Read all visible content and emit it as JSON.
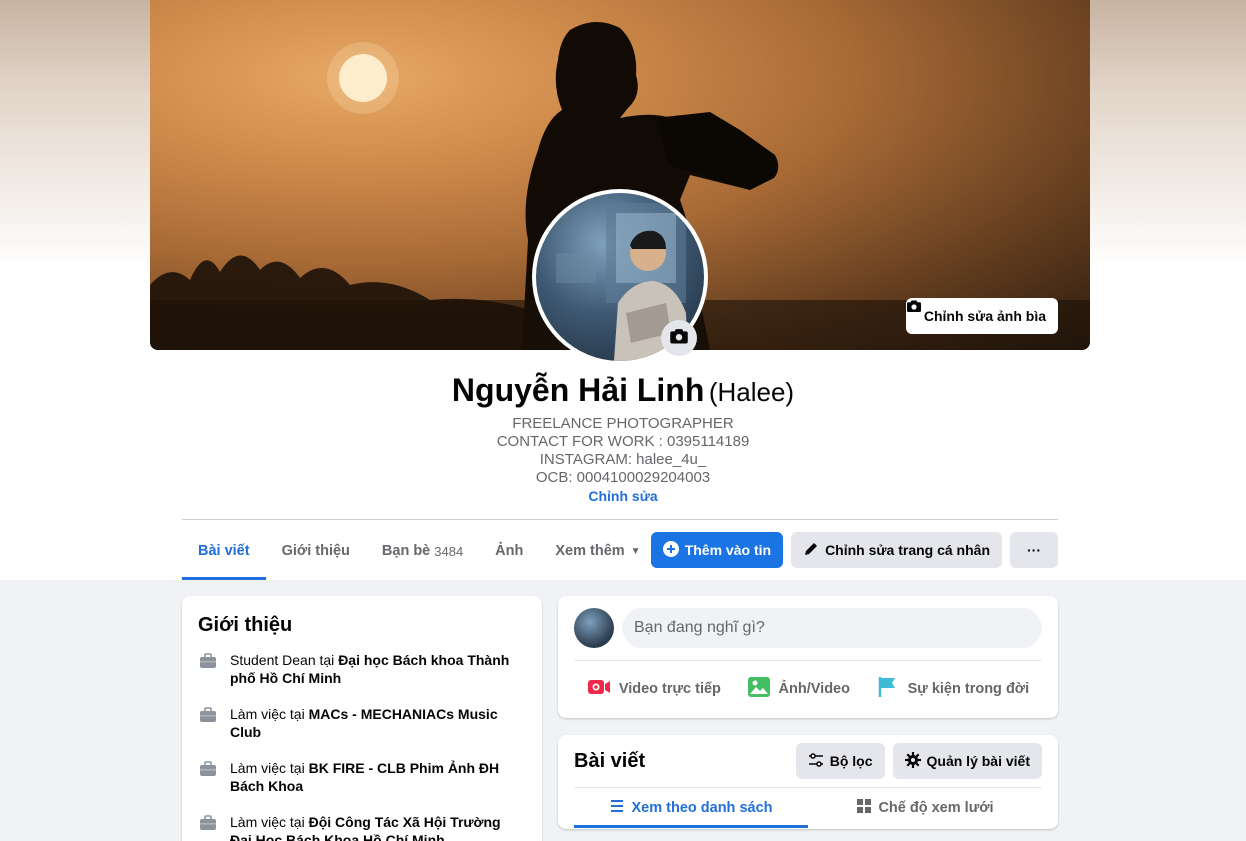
{
  "cover": {
    "edit_button": "Chỉnh sửa ảnh bìa"
  },
  "profile": {
    "name": "Nguyễn Hải Linh",
    "alternate_name": "(Halee)",
    "bio_lines": [
      "FREELANCE PHOTOGRAPHER",
      "CONTACT FOR WORK : 0395114189",
      "INSTAGRAM: halee_4u_",
      "OCB: 0004100029204003"
    ],
    "bio_edit": "Chỉnh sửa"
  },
  "tabs": [
    {
      "label": "Bài viết",
      "active": true
    },
    {
      "label": "Giới thiệu"
    },
    {
      "label": "Bạn bè",
      "count": "3484"
    },
    {
      "label": "Ảnh"
    },
    {
      "label": "Xem thêm"
    }
  ],
  "actions": {
    "add_story": "Thêm vào tin",
    "edit_profile": "Chỉnh sửa trang cá nhân",
    "more": "···"
  },
  "intro": {
    "title": "Giới thiệu",
    "items": [
      {
        "prefix": "Student Dean tại ",
        "place": "Đại học Bách khoa Thành phố Hồ Chí Minh"
      },
      {
        "prefix": "Làm việc tại ",
        "place": "MACs - MECHANIACs Music Club"
      },
      {
        "prefix": "Làm việc tại ",
        "place": "BK FIRE - CLB Phim Ảnh ĐH Bách Khoa"
      },
      {
        "prefix": "Làm việc tại ",
        "place": "Đội Công Tác Xã Hội Trường Đại Học Bách Khoa Hồ Chí Minh"
      }
    ]
  },
  "composer": {
    "placeholder": "Bạn đang nghĩ gì?",
    "live_video": "Video trực tiếp",
    "photo_video": "Ảnh/Video",
    "life_event": "Sự kiện trong đời"
  },
  "posts": {
    "title": "Bài viết",
    "filter": "Bộ lọc",
    "manage": "Quản lý bài viết",
    "list_view": "Xem theo danh sách",
    "grid_view": "Chế độ xem lưới"
  },
  "colors": {
    "accent": "#1b74e4",
    "link": "#216fdb",
    "live": "#f02849",
    "photo": "#45bd62",
    "event": "#3ebbd6"
  }
}
